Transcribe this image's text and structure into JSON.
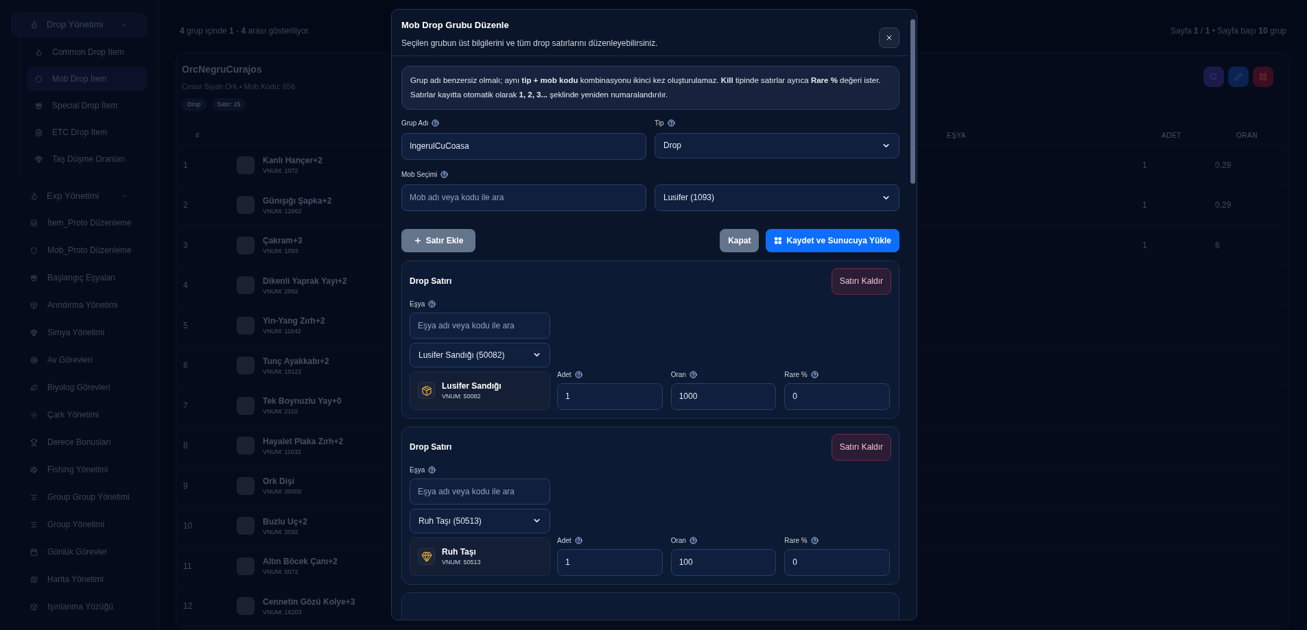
{
  "sidebar": {
    "items": [
      {
        "kind": "group",
        "label": "Drop Yönetimi",
        "expanded": true,
        "children": [
          {
            "label": "Common Drop İtem",
            "selected": false
          },
          {
            "label": "Mob Drop İtem",
            "selected": true
          },
          {
            "label": "Special Drop İtem",
            "selected": false
          },
          {
            "label": "ETC Drop İtem",
            "selected": false
          },
          {
            "label": "Taş Düşme Oranları",
            "selected": false
          }
        ]
      },
      {
        "kind": "group",
        "label": "Exp Yönetimi",
        "expanded": false
      },
      {
        "kind": "link",
        "label": "İtem_Proto Düzenleme"
      },
      {
        "kind": "link",
        "label": "Mob_Proto Düzenleme"
      },
      {
        "kind": "link",
        "label": "Başlangıç Eşyaları"
      },
      {
        "kind": "link",
        "label": "Arındırma Yönetimi"
      },
      {
        "kind": "link",
        "label": "Simya Yönetimi"
      },
      {
        "kind": "link",
        "label": "Av Görevleri"
      },
      {
        "kind": "link",
        "label": "Biyolog Görevleri"
      },
      {
        "kind": "link",
        "label": "Çark Yönetimi"
      },
      {
        "kind": "link",
        "label": "Derece Bonusları"
      },
      {
        "kind": "link",
        "label": "Fishing Yönetimi"
      },
      {
        "kind": "link",
        "label": "Group Group Yönetimi"
      },
      {
        "kind": "link",
        "label": "Group Yönetimi"
      },
      {
        "kind": "link",
        "label": "Günlük Görevler"
      },
      {
        "kind": "link",
        "label": "Harita Yönetimi"
      },
      {
        "kind": "link",
        "label": "Işınlanma Yüzüğü"
      }
    ]
  },
  "summary": "**4** grup içinde **1** - **4** arası gösteriliyor.",
  "pagination": "Sayfa **1** / **1** • Sayfa başı **10** grup",
  "group": {
    "name": "OrcNegruCurajos",
    "subtitle": "Cesur Siyah Ork • Mob Kodu: 656",
    "tags": [
      "Drop",
      "Satır: 15"
    ],
    "columns": [
      "#",
      "EŞYA",
      "ADET",
      "ORAN"
    ],
    "rows": [
      {
        "number": "1",
        "name": "Kanlı Hançer+2",
        "vnum": "VNUM: 1072",
        "adet": "1",
        "oran": "0.29"
      },
      {
        "number": "2",
        "name": "Günışığı Şapka+2",
        "vnum": "VNUM: 12662",
        "adet": "1",
        "oran": "0.29"
      },
      {
        "number": "3",
        "name": "Çakram+3",
        "vnum": "VNUM: 1093",
        "adet": "1",
        "oran": "6"
      },
      {
        "number": "4",
        "name": "Dikenli Yaprak Yayı+2",
        "vnum": "VNUM: 2092"
      },
      {
        "number": "5",
        "name": "Yin-Yang Zırh+2",
        "vnum": "VNUM: 11642"
      },
      {
        "number": "6",
        "name": "Tunç Ayakkabı+2",
        "vnum": "VNUM: 15122"
      },
      {
        "number": "7",
        "name": "Tek Boynuzlu Yay+0",
        "vnum": "VNUM: 2110"
      },
      {
        "number": "8",
        "name": "Hayalet Plaka Zırh+2",
        "vnum": "VNUM: 11632"
      },
      {
        "number": "9",
        "name": "Ork Dişi",
        "vnum": "VNUM: 30006"
      },
      {
        "number": "10",
        "name": "Buzlu Uç+2",
        "vnum": "VNUM: 3092"
      },
      {
        "number": "11",
        "name": "Altın Böcek Çanı+2",
        "vnum": "VNUM: 5072"
      },
      {
        "number": "12",
        "name": "Cennetin Gözü Kolye+3",
        "vnum": "VNUM: 16203"
      }
    ]
  },
  "modal": {
    "title": "Mob Drop Grubu Düzenle",
    "subtitle": "Seçilen grubun üst bilgilerini ve tüm drop satırlarını düzenleyebilirsiniz.",
    "info": "Grup adı benzersiz olmalı; aynı **tip + mob kodu** kombinasyonu ikinci kez oluşturulamaz. **Kill** tipinde satırlar ayrıca **Rare %** değeri ister. Satırlar kayıtta otomatik olarak **1, 2, 3...** şeklinde yeniden numaralandırılır.",
    "group_name": {
      "label": "Grup Adı",
      "value": "IngerulCuCoasa"
    },
    "type": {
      "label": "Tip",
      "value": "Drop"
    },
    "mob": {
      "label": "Mob Seçimi",
      "placeholder": "Mob adı veya kodu ile ara",
      "value": "Lusifer (1093)"
    },
    "buttons": [
      {
        "kind": "add",
        "label": "Satır Ekle"
      },
      {
        "kind": "secondary",
        "label": "Kapat"
      },
      {
        "kind": "primary",
        "label": "Kaydet ve Sunucuya Yükle"
      }
    ],
    "rows": [
      {
        "kind": "chest",
        "title": "Drop Satırı",
        "remove_label": "Satırı Kaldır",
        "item_label": "Eşya",
        "search_placeholder": "Eşya adı veya kodu ile ara",
        "selected_item": "Lusifer Sandığı (50082)",
        "preview_name": "Lusifer Sandığı",
        "preview_vnum": "VNUM: 50082",
        "fields": [
          {
            "label": "Adet",
            "value": "1"
          },
          {
            "label": "Oran",
            "value": "1000"
          },
          {
            "label": "Rare %",
            "value": "0"
          }
        ]
      },
      {
        "kind": "gem",
        "title": "Drop Satırı",
        "remove_label": "Satırı Kaldır",
        "item_label": "Eşya",
        "search_placeholder": "Eşya adı veya kodu ile ara",
        "selected_item": "Ruh Taşı (50513)",
        "preview_name": "Ruh Taşı",
        "preview_vnum": "VNUM: 50513",
        "fields": [
          {
            "label": "Adet",
            "value": "1"
          },
          {
            "label": "Oran",
            "value": "100"
          },
          {
            "label": "Rare %",
            "value": "0"
          }
        ]
      }
    ]
  }
}
